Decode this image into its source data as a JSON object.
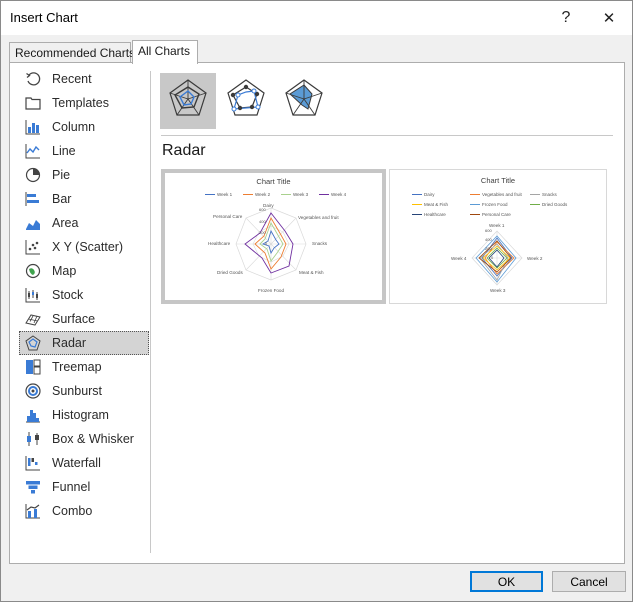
{
  "window": {
    "title": "Insert Chart",
    "help_label": "?",
    "close_label": "✕"
  },
  "tabs": [
    {
      "label": "Recommended Charts",
      "active": false
    },
    {
      "label": "All Charts",
      "active": true
    }
  ],
  "sidebar": {
    "items": [
      {
        "label": "Recent",
        "icon": "recent-icon"
      },
      {
        "label": "Templates",
        "icon": "templates-icon"
      },
      {
        "label": "Column",
        "icon": "column-chart-icon"
      },
      {
        "label": "Line",
        "icon": "line-chart-icon"
      },
      {
        "label": "Pie",
        "icon": "pie-chart-icon"
      },
      {
        "label": "Bar",
        "icon": "bar-chart-icon"
      },
      {
        "label": "Area",
        "icon": "area-chart-icon"
      },
      {
        "label": "X Y (Scatter)",
        "icon": "scatter-chart-icon"
      },
      {
        "label": "Map",
        "icon": "map-chart-icon"
      },
      {
        "label": "Stock",
        "icon": "stock-chart-icon"
      },
      {
        "label": "Surface",
        "icon": "surface-chart-icon"
      },
      {
        "label": "Radar",
        "icon": "radar-chart-icon",
        "selected": true
      },
      {
        "label": "Treemap",
        "icon": "treemap-icon"
      },
      {
        "label": "Sunburst",
        "icon": "sunburst-icon"
      },
      {
        "label": "Histogram",
        "icon": "histogram-icon"
      },
      {
        "label": "Box & Whisker",
        "icon": "box-whisker-icon"
      },
      {
        "label": "Waterfall",
        "icon": "waterfall-icon"
      },
      {
        "label": "Funnel",
        "icon": "funnel-icon"
      },
      {
        "label": "Combo",
        "icon": "combo-chart-icon"
      }
    ]
  },
  "subtypes": [
    {
      "icon": "radar-icon",
      "selected": true
    },
    {
      "icon": "radar-with-markers-icon",
      "selected": false
    },
    {
      "icon": "filled-radar-icon",
      "selected": false
    }
  ],
  "section_title": "Radar",
  "previews": [
    {
      "title": "Chart Title",
      "legend": [
        "Week 1",
        "Week 2",
        "Week 3",
        "Week 4"
      ],
      "axis_labels": [
        "Dairy",
        "Vegetables and fruit",
        "Snacks",
        "Meat & Fish",
        "Frozen Food",
        "Dried Goods",
        "Healthcare",
        "Personal Care"
      ],
      "tick_labels": [
        "600",
        "400",
        "200",
        "0"
      ]
    },
    {
      "title": "Chart Title",
      "legend": [
        "Dairy",
        "Vegetables and fruit",
        "Snacks",
        "Meat & Fish",
        "Frozen Food",
        "Dried Goods",
        "Healthcare",
        "Personal Care"
      ],
      "axis_labels": [
        "Week 1",
        "Week 2",
        "Week 3",
        "Week 4"
      ],
      "tick_labels": [
        "600",
        "400",
        "200",
        "0"
      ]
    }
  ],
  "colors": {
    "accent": "#0078d7",
    "series": [
      "#4472c4",
      "#ed7d31",
      "#a5a5a5",
      "#ffc000",
      "#5b9bd5",
      "#70ad47",
      "#264478",
      "#9e480e"
    ],
    "preview1_series": [
      "#4472c4",
      "#ed7d31",
      "#a9d18e",
      "#7030a0"
    ]
  },
  "buttons": {
    "ok": "OK",
    "cancel": "Cancel"
  }
}
